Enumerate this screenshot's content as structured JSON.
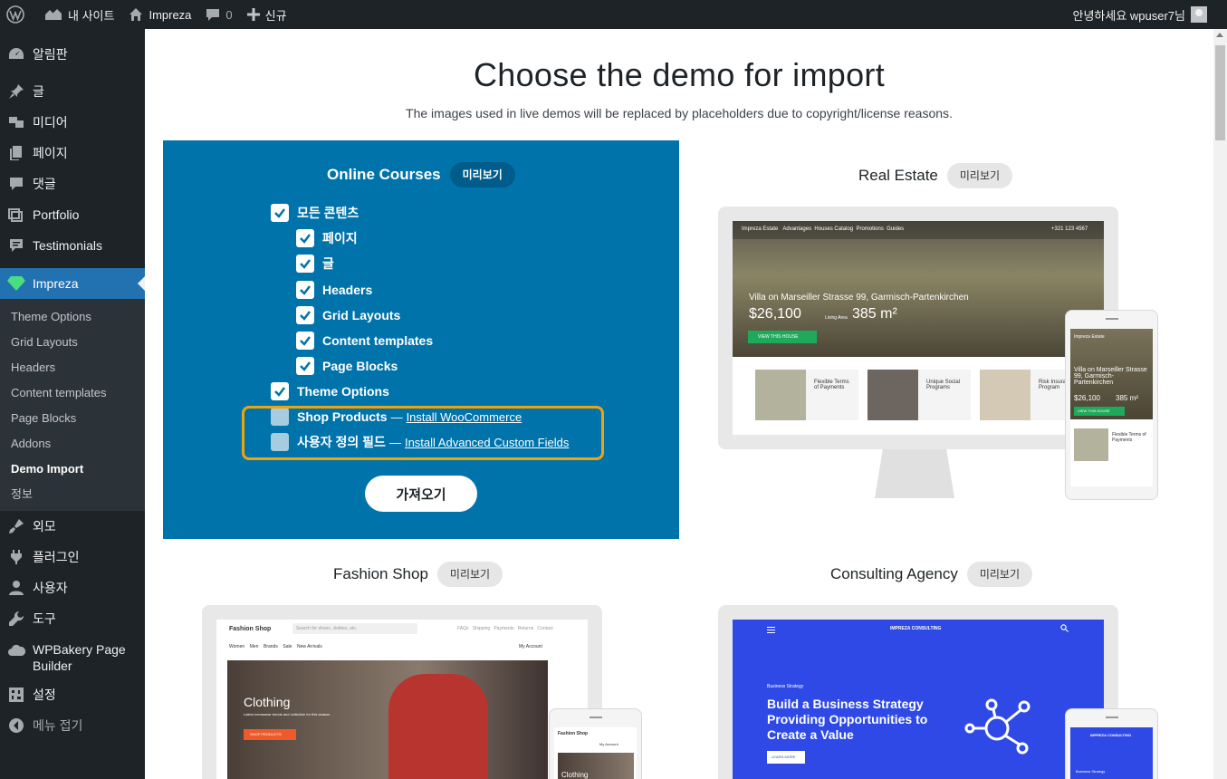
{
  "adminbar": {
    "site_label": "내 사이트",
    "theme_label": "Impreza",
    "comments_count": "0",
    "new_label": "신규",
    "greeting": "안녕하세요 wpuser7님"
  },
  "sidebar": {
    "dashboard": "알림판",
    "posts": "글",
    "media": "미디어",
    "pages": "페이지",
    "comments": "댓글",
    "portfolio": "Portfolio",
    "testimonials": "Testimonials",
    "impreza": "Impreza",
    "submenu": [
      "Theme Options",
      "Grid Layouts",
      "Headers",
      "Content templates",
      "Page Blocks",
      "Addons",
      "Demo Import",
      "정보"
    ],
    "appearance": "외모",
    "plugins": "플러그인",
    "users": "사용자",
    "tools": "도구",
    "wpbakery": "WPBakery Page Builder",
    "settings": "설정",
    "collapse": "메뉴 접기"
  },
  "main": {
    "title": "Choose the demo for import",
    "subtitle": "The images used in live demos will be replaced by placeholders due to copyright/license reasons.",
    "preview_label": "미리보기",
    "import_label": "가져오기"
  },
  "demos": {
    "online_courses": "Online Courses",
    "real_estate": "Real Estate",
    "fashion_shop": "Fashion Shop",
    "consulting_agency": "Consulting Agency"
  },
  "options": {
    "all_content": "모든 콘텐츠",
    "pages": "페이지",
    "posts": "글",
    "headers": "Headers",
    "grid_layouts": "Grid Layouts",
    "content_templates": "Content templates",
    "page_blocks": "Page Blocks",
    "theme_options": "Theme Options",
    "shop_products": "Shop Products",
    "shop_dash": "—",
    "shop_link": "Install WooCommerce",
    "custom_fields": "사용자 정의 필드",
    "custom_dash": "—",
    "custom_link": "Install Advanced Custom Fields"
  },
  "mock_real_estate": {
    "nav": [
      "Impreza Estate",
      "Advantages",
      "Houses Catalog",
      "Promotions",
      "Guides"
    ],
    "phone_no": "+321 123 4567",
    "address": "Villa on Marseiller Strasse 99, Garmisch-Partenkirchen",
    "price": "$26,100",
    "area_label": "Living Area",
    "area": "385 m²",
    "cta": "VIEW THIS HOUSE",
    "f1": "Flexible Terms of Payments",
    "f2": "Unique Social Programs",
    "f3": "Risk Insurance Program",
    "m_brand": "Impreza Estate",
    "m_addr": "Villa on Marseiller Strasse 99, Garmisch-Partenkirchen",
    "m_price": "$26,100",
    "m_area": "385 m²",
    "m_cta": "VIEW THIS HOUSE",
    "m_f1": "Flexible Terms of Payments"
  },
  "mock_fashion": {
    "brand": "Fashion Shop",
    "search": "Search for shoes, clothes, etc.",
    "links": [
      "FAQs",
      "Shipping",
      "Payments",
      "Returns",
      "Contact"
    ],
    "cats": [
      "Women",
      "Men",
      "Brands",
      "Sale",
      "New Arrivals"
    ],
    "account": "My Account",
    "hero": "Clothing",
    "hero_sub": "Latest menswear trends and collection for this season",
    "cta": "SHOP PRODUCTS",
    "m_brand": "Fashion Shop",
    "m_account": "My Account",
    "m_hero": "Clothing"
  },
  "mock_consulting": {
    "brand": "IMPREZA CONSULTING",
    "kicker": "Business Strategy",
    "headline": "Build a Business Strategy Providing Opportunities to Create a Value",
    "cta": "LEARN MORE",
    "m_brand": "IMPREZA CONSULTING",
    "m_kicker": "Business Strategy"
  }
}
